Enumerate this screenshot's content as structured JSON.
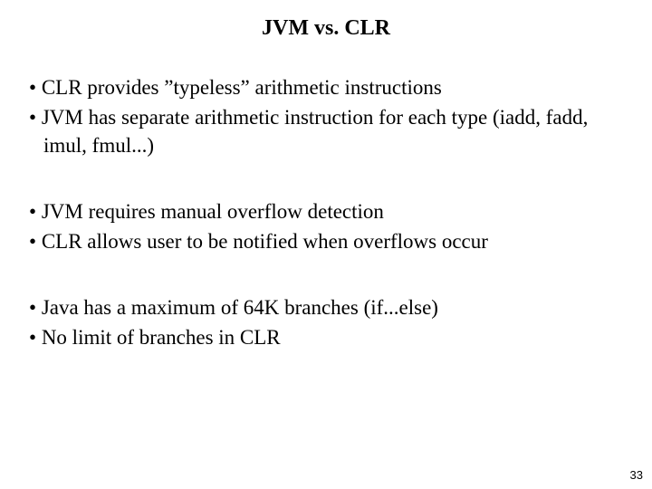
{
  "title": "JVM vs. CLR",
  "groups": [
    {
      "bullets": [
        "CLR provides ”typeless” arithmetic instructions",
        "JVM has separate arithmetic instruction for each type (iadd, fadd, imul, fmul...)"
      ]
    },
    {
      "bullets": [
        "JVM requires manual overflow detection",
        "CLR allows user to be notified when overflows occur"
      ]
    },
    {
      "bullets": [
        "Java has a maximum of 64K branches (if...else)",
        "No limit of branches in CLR"
      ]
    }
  ],
  "page_number": "33"
}
